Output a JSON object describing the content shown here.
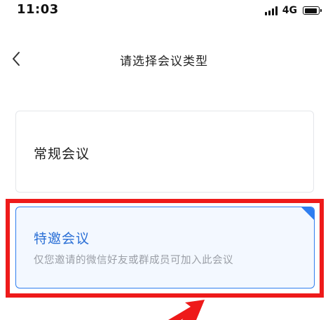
{
  "status_bar": {
    "time": "11:03",
    "network": "4G",
    "signal_icon": "signal-bars-icon",
    "battery_icon": "battery-icon"
  },
  "nav": {
    "back_icon": "chevron-left-icon",
    "title": "请选择会议类型"
  },
  "options": [
    {
      "title": "常规会议",
      "description": "",
      "selected": false
    },
    {
      "title": "特邀会议",
      "description": "仅您邀请的微信好友或群成员可加入此会议",
      "selected": true
    }
  ],
  "colors": {
    "accent": "#2f7ef0",
    "accent_text": "#2a6fd6",
    "selected_bg": "#f3f8ff",
    "annotation_red": "#ee1a1a",
    "muted_text": "#9a9ea6"
  },
  "annotation": {
    "highlight_icon": "red-highlight-box",
    "arrow_icon": "red-arrow-icon"
  }
}
